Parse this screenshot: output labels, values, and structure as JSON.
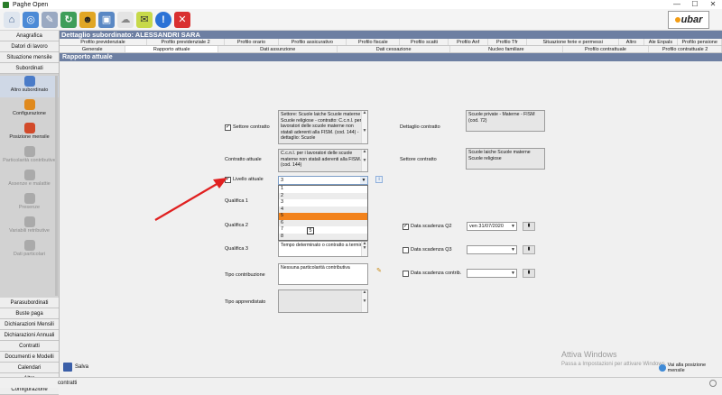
{
  "window": {
    "title": "Paghe Open",
    "controls": [
      "—",
      "☐",
      "✕"
    ]
  },
  "toolbar": {
    "icons": [
      "home-icon",
      "network-icon",
      "tools-icon",
      "sync-icon",
      "agent-icon",
      "monitor-icon",
      "cloud-icon",
      "notes-icon",
      "info-icon",
      "close-icon"
    ],
    "logo": "ubar"
  },
  "sidebar": {
    "top_items": [
      "Anagrafica",
      "Datori di lavoro",
      "Situazione mensile",
      "Subordinati"
    ],
    "tools": [
      {
        "label": "Altro subordinato",
        "enabled": true,
        "color": "#4a7bc8"
      },
      {
        "label": "Configurazione",
        "enabled": true,
        "color": "#e08a1e"
      },
      {
        "label": "Posizione mensile",
        "enabled": true,
        "color": "#d24a2a"
      },
      {
        "label": "Particolarità contributive",
        "enabled": false,
        "color": "#aaaaaa"
      },
      {
        "label": "Assenze e malattie",
        "enabled": false,
        "color": "#aaaaaa"
      },
      {
        "label": "Presenze",
        "enabled": false,
        "color": "#aaaaaa"
      },
      {
        "label": "Variabili retributive",
        "enabled": false,
        "color": "#aaaaaa"
      },
      {
        "label": "Dati particolari",
        "enabled": false,
        "color": "#aaaaaa"
      }
    ],
    "bottom_items": [
      "Parasubordinati",
      "Buste paga",
      "Dichiarazioni Mensili",
      "Dichiarazioni Annuali",
      "Contratti",
      "Documenti e Modelli",
      "Calendari",
      "Altro",
      "Configurazione"
    ]
  },
  "detail": {
    "title": "Dettaglio subordinato: ALESSANDRI SARA",
    "tabs_row1": [
      "Profilo previdenziale",
      "Profilo previdenziale 2",
      "Profilo orario",
      "Profilo assicurativo",
      "Profilo fiscale",
      "Profilo scatti",
      "Profilo Anf",
      "Profilo Tfr",
      "Situazione ferie e permessi",
      "Altro",
      "Ale Enpals",
      "Profilo pensione"
    ],
    "tabs_row2": [
      "Generale",
      "Rapporto attuale",
      "Dati assunzione",
      "Dati cessazione",
      "Nucleo familiare",
      "Profilo contrattuale",
      "Profilo contrattuale 2"
    ],
    "section_title": "Rapporto attuale"
  },
  "form": {
    "settore_contratto_label": "Settore contratto",
    "settore_contratto_value": "Settore: Scuole laiche Scuole materne Scuole religiose - contratto: C.c.n.l. per i lavoratori delle scuole materne non statali aderenti alla FISM. (cod. 144) - dettaglio: Scuole",
    "contratto_attuale_label": "Contratto attuale",
    "contratto_attuale_value": "C.c.n.l. per i lavoratori delle scuole materne non statali aderenti alla FISM. (cod. 144)",
    "livello_attuale_label": "Livello attuale",
    "livello_attuale_value": "3",
    "livello_options": [
      "1",
      "2",
      "3",
      "4",
      "5",
      "6",
      "7",
      "8"
    ],
    "livello_highlighted": "5",
    "tooltip": "5",
    "qualifica1_label": "Qualifica 1",
    "qualifica2_label": "Qualifica 2",
    "qualifica3_label": "Qualifica 3",
    "qualifica3_value": "Tempo determinato o contratto a termine",
    "tipo_contribuzione_label": "Tipo contribuzione",
    "tipo_contribuzione_value": "Nessuna particolarità contributiva",
    "tipo_apprendistato_label": "Tipo apprendistato",
    "dettaglio_contratto_label": "Dettaglio contratto",
    "dettaglio_contratto_value": "Scuole private - Materne - FISM (cod. 72)",
    "settore_contratto2_label": "Settore contratto",
    "settore_contratto2_value": "Scuole laiche Scuole materne Scuole religiose",
    "data_q2_label": "Data scadenza Q2",
    "data_q2_value": "ven 31/07/2020",
    "data_q3_label": "Data scadenza Q3",
    "data_contrib_label": "Data scadenza contrib."
  },
  "bottom": {
    "save_label": "Salva",
    "goto_label": "Vai alla posizione mensile"
  },
  "status": {
    "text": "contratti"
  },
  "watermark": {
    "line1": "Attiva Windows",
    "line2": "Passa a Impostazioni per attivare Windows."
  },
  "colors": {
    "header": "#6d7fa2",
    "highlight": "#f2821b",
    "arrow": "#e02020"
  }
}
